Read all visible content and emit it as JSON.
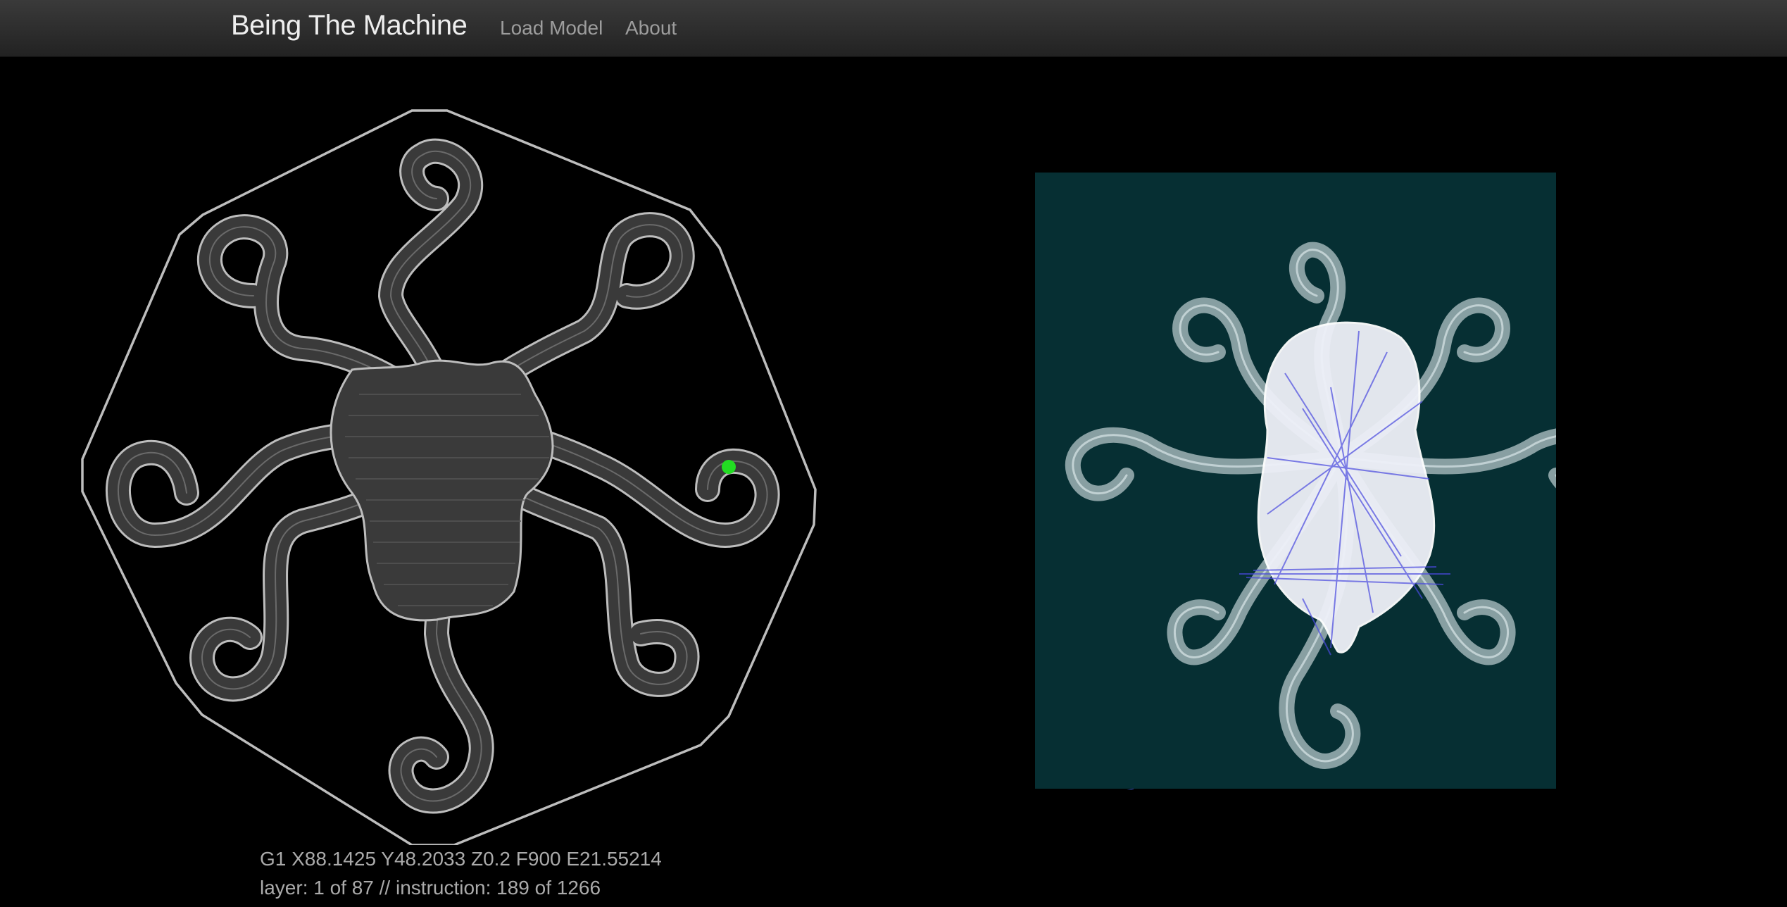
{
  "navbar": {
    "brand": "Being The Machine",
    "links": [
      {
        "label": "Load Model"
      },
      {
        "label": "About"
      }
    ]
  },
  "toolpath": {
    "current_gcode": "G1 X88.1425 Y48.2033 Z0.2 F900 E21.55214",
    "status": "layer: 1 of 87 // instruction: 189 of 1266"
  },
  "colors": {
    "background": "#000000",
    "navbar": "#2a2a2a",
    "outline": "#bdbdbd",
    "fill": "#3a3a3a",
    "nozzle": "#22dd22",
    "preview_bg": "#062f33",
    "preview_strands": "#c9d6da",
    "preview_travel": "#4a4adf"
  },
  "icons": {
    "nozzle": "nozzle-position-marker"
  }
}
